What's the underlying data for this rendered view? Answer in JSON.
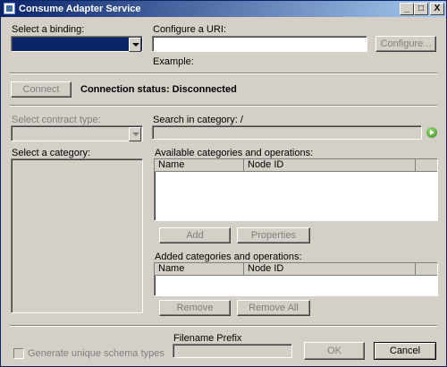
{
  "window": {
    "title": "Consume Adapter Service",
    "minimize": "_",
    "maximize": "□",
    "close": "X"
  },
  "binding": {
    "label": "Select a binding:",
    "value": ""
  },
  "uri": {
    "label": "Configure a URI:",
    "value": "",
    "configure_button": "Configure...",
    "example_label": "Example:"
  },
  "connection": {
    "connect_button": "Connect",
    "status": "Connection status: Disconnected"
  },
  "contract": {
    "label": "Select contract type:",
    "value": ""
  },
  "search": {
    "label": "Search in category: /",
    "value": ""
  },
  "category": {
    "label": "Select a category:"
  },
  "available": {
    "label": "Available categories and operations:",
    "columns": [
      "Name",
      "Node ID"
    ]
  },
  "actions": {
    "add": "Add",
    "properties": "Properties",
    "remove": "Remove",
    "remove_all": "Remove All"
  },
  "added": {
    "label": "Added categories and operations:",
    "columns": [
      "Name",
      "Node ID"
    ]
  },
  "footer": {
    "unique_schema": "Generate unique schema types",
    "filename_prefix_label": "Filename Prefix",
    "filename_prefix_value": "",
    "ok": "OK",
    "cancel": "Cancel"
  },
  "colors": {
    "title_start": "#0a246a",
    "title_end": "#a6caf0",
    "face": "#d4d0c8",
    "selection": "#0a246a",
    "go_icon": "#3a9a22"
  }
}
